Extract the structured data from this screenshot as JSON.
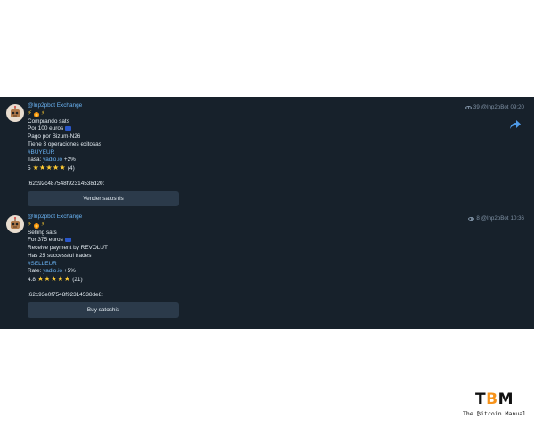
{
  "colors": {
    "panel_bg": "#17212b",
    "text": "#e4ecf2",
    "link": "#6ab3f3",
    "button_bg": "#2b3a4a",
    "meta": "#7f91a4",
    "logo_accent": "#f7931a"
  },
  "messages": [
    {
      "sender": "@lnp2pbot Exchange",
      "lines": {
        "title": "Comprando sats",
        "amount": "Por 100 euros",
        "payment": "Pago por Bizum-N26",
        "trades": "Tiene 3 operaciones exitosas",
        "tag": "#BUYEUR",
        "rate_label": "Tasa:",
        "rate_link": "yadio.io",
        "rate_value": "+2%",
        "rating": "5",
        "rating_count": "(4)",
        "order_id": ":62c92c487548f92314538d20:"
      },
      "button_label": "Vender satoshis",
      "views": "39",
      "via": "@lnp2pBot",
      "time": "09:20",
      "icons": [
        "bolt-icon",
        "fire-icon",
        "bolt-icon",
        "eu-flag-icon",
        "star-icon",
        "eye-icon",
        "share-icon"
      ]
    },
    {
      "sender": "@lnp2pbot Exchange",
      "lines": {
        "title": "Selling sats",
        "amount": "For 375 euros",
        "payment": "Receive payment by REVOLUT",
        "trades": "Has 25 successful trades",
        "tag": "#SELLEUR",
        "rate_label": "Rate:",
        "rate_link": "yadio.io",
        "rate_value": "+5%",
        "rating": "4.8",
        "rating_count": "(21)",
        "order_id": ":62c93e0f7548f92314538de8:"
      },
      "button_label": "Buy satoshis",
      "views": "8",
      "via": "@lnp2pBot",
      "time": "10:36",
      "icons": [
        "bolt-icon",
        "fire-icon",
        "bolt-icon",
        "eu-flag-icon",
        "star-icon",
        "eye-icon"
      ]
    }
  ],
  "logo": {
    "mark_prefix": "T",
    "mark_accent": "B",
    "mark_suffix": "M",
    "subtitle": "The ₿itcoin Manual"
  }
}
